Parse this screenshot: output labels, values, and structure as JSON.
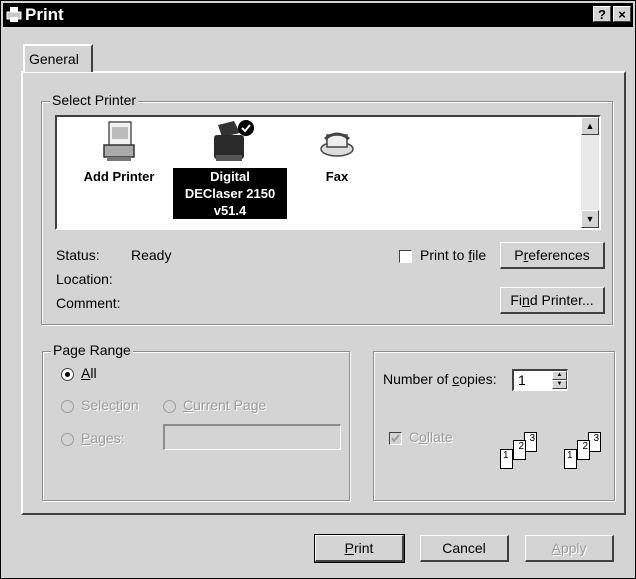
{
  "window": {
    "title": "Print",
    "help_button": "?",
    "close_button": "×"
  },
  "tabs": [
    {
      "label": "General"
    }
  ],
  "select_printer": {
    "legend": "Select Printer",
    "printers": [
      {
        "name": "Add Printer"
      },
      {
        "name_line1": "Digital",
        "name_line2": "DEClaser 2150",
        "name_line3": "v51.4",
        "selected": true
      },
      {
        "name": "Fax"
      }
    ],
    "status_label": "Status:",
    "status_value": "Ready",
    "location_label": "Location:",
    "location_value": "",
    "comment_label": "Comment:",
    "comment_value": "",
    "print_to_file": {
      "pre": "Print to ",
      "ul": "f",
      "post": "ile",
      "checked": false
    },
    "preferences_button": {
      "pre": "P",
      "ul": "r",
      "post": "eferences"
    },
    "find_printer_button": {
      "pre": "Fi",
      "ul": "n",
      "post": "d Printer..."
    }
  },
  "page_range": {
    "legend": "Page Range",
    "all": {
      "pre": "",
      "ul": "A",
      "post": "ll",
      "selected": true
    },
    "selection": {
      "pre": "Selec",
      "ul": "t",
      "post": "ion"
    },
    "current_page": {
      "pre": "",
      "ul": "C",
      "post": "urrent Page"
    },
    "pages": {
      "pre": "",
      "ul": "P",
      "post": "ages:",
      "value": ""
    }
  },
  "copies": {
    "label_pre": "Number of ",
    "label_ul": "c",
    "label_post": "opies:",
    "value": "1",
    "collate": {
      "pre": "C",
      "ul": "o",
      "post": "llate",
      "checked": true
    },
    "sheet_numbers": [
      "1",
      "2",
      "3"
    ]
  },
  "footer": {
    "print_button": {
      "pre": "",
      "ul": "P",
      "post": "rint"
    },
    "cancel_button": "Cancel",
    "apply_button": {
      "pre": "",
      "ul": "A",
      "post": "pply"
    }
  }
}
